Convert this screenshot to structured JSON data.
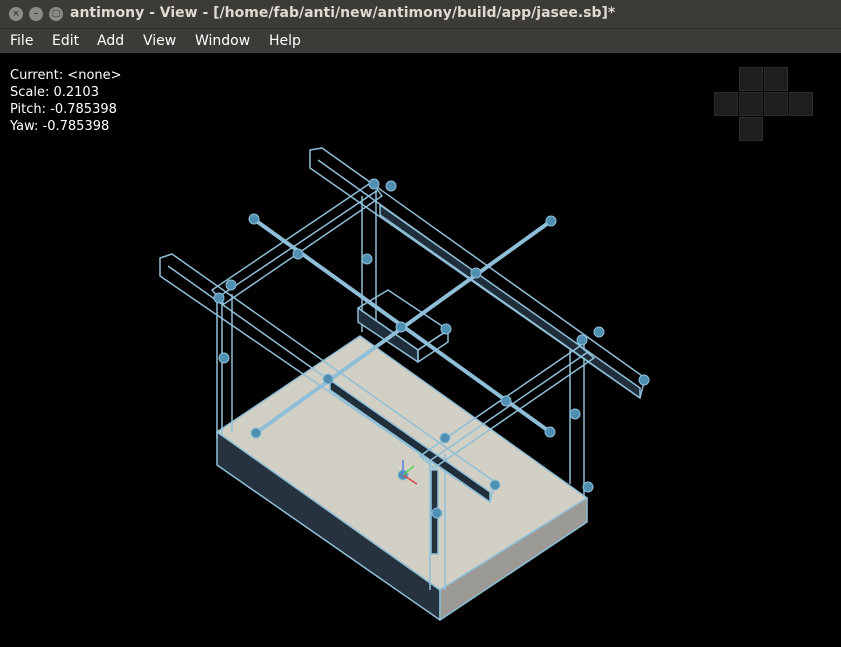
{
  "window": {
    "title": "antimony - View - [/home/fab/anti/new/antimony/build/app/jasee.sb]*",
    "controls": [
      "close-icon",
      "minimize-icon",
      "maximize-icon"
    ]
  },
  "menu": {
    "items": [
      {
        "label": "File"
      },
      {
        "label": "Edit"
      },
      {
        "label": "Add"
      },
      {
        "label": "View"
      },
      {
        "label": "Window"
      },
      {
        "label": "Help"
      }
    ]
  },
  "hud": {
    "current": "Current: <none>",
    "scale": "Scale: 0.2103",
    "pitch": "Pitch: -0.785398",
    "yaw": "Yaw: -0.785398"
  },
  "colors": {
    "background": "#000000",
    "titlebar": "#3c3b37",
    "wire": "#8fbfd8",
    "handle": "#4f8fb2",
    "platform_top": "#d2cfc4",
    "platform_front": "#26323d",
    "platform_side": "#9c9a94",
    "axis_x": "#d94a4a",
    "axis_y": "#5bd15b",
    "axis_z": "#5a7fe0"
  }
}
